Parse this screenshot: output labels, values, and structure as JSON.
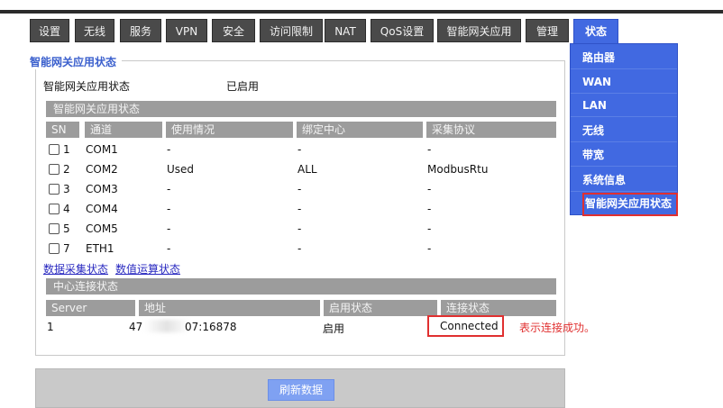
{
  "nav": {
    "tabs": [
      "设置",
      "无线",
      "服务",
      "VPN",
      "安全",
      "访问限制",
      "NAT",
      "QoS设置",
      "智能网关应用",
      "管理",
      "状态"
    ],
    "active": "状态"
  },
  "submenu": {
    "items": [
      "路由器",
      "WAN",
      "LAN",
      "无线",
      "带宽",
      "系统信息",
      "智能网关应用状态"
    ],
    "selected": "智能网关应用状态"
  },
  "main": {
    "section_title": "智能网关应用状态",
    "status_label": "智能网关应用状态",
    "status_value": "已启用",
    "app_table": {
      "title": "智能网关应用状态",
      "headers": [
        "SN",
        "通道",
        "使用情况",
        "绑定中心",
        "采集协议"
      ],
      "rows": [
        {
          "sn": "1",
          "channel": "COM1",
          "usage": "-",
          "center": "-",
          "protocol": "-"
        },
        {
          "sn": "2",
          "channel": "COM2",
          "usage": "Used",
          "center": "ALL",
          "protocol": "ModbusRtu"
        },
        {
          "sn": "3",
          "channel": "COM3",
          "usage": "-",
          "center": "-",
          "protocol": "-"
        },
        {
          "sn": "4",
          "channel": "COM4",
          "usage": "-",
          "center": "-",
          "protocol": "-"
        },
        {
          "sn": "5",
          "channel": "COM5",
          "usage": "-",
          "center": "-",
          "protocol": "-"
        },
        {
          "sn": "7",
          "channel": "ETH1",
          "usage": "-",
          "center": "-",
          "protocol": "-"
        }
      ]
    },
    "links": [
      "数据采集状态",
      "数值运算状态"
    ],
    "conn_table": {
      "title": "中心连接状态",
      "headers": [
        "Server",
        "地址",
        "启用状态",
        "连接状态"
      ],
      "row": {
        "server": "1",
        "address_left": "47",
        "address_right": "07:16878",
        "enabled": "启用",
        "status": "Connected"
      }
    },
    "annotation": "表示连接成功。"
  },
  "footer": {
    "refresh_label": "刷新数据"
  },
  "colors": {
    "accent": "#4169e1",
    "highlight": "#e03030",
    "tab_bg": "#4a4a4a",
    "header_gray": "#9c9c9c"
  }
}
